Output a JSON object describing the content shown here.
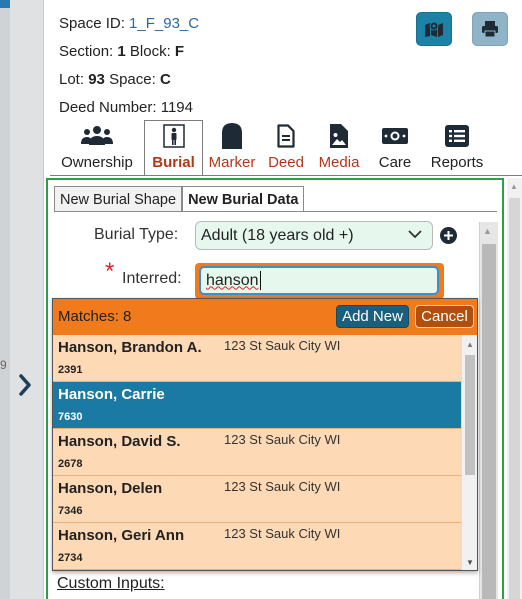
{
  "space_info": {
    "space_id_label": "Space ID:",
    "space_id_value": "1_F_93_C",
    "section_label": "Section:",
    "section_value": "1",
    "block_label": "Block:",
    "block_value": "F",
    "lot_label": "Lot:",
    "lot_value": "93",
    "space_label": "Space:",
    "space_value": "C",
    "deed_label": "Deed Number:",
    "deed_value": "1194"
  },
  "toolbar": {
    "map_icon": "map-icon",
    "print_icon": "printer-icon"
  },
  "tabs": [
    {
      "label": "Ownership",
      "icon": "users-icon"
    },
    {
      "label": "Burial",
      "icon": "person-icon",
      "active": true
    },
    {
      "label": "Marker",
      "icon": "tombstone-icon"
    },
    {
      "label": "Deed",
      "icon": "document-icon"
    },
    {
      "label": "Media",
      "icon": "file-image-icon"
    },
    {
      "label": "Care",
      "icon": "money-icon"
    },
    {
      "label": "Reports",
      "icon": "list-icon"
    }
  ],
  "subtabs": [
    {
      "label": "New Burial Shape"
    },
    {
      "label": "New Burial Data",
      "active": true
    }
  ],
  "form": {
    "burial_type_label": "Burial Type:",
    "burial_type_value": "Adult (18 years old +)",
    "required_star": "*",
    "interred_label": "Interred:",
    "interred_value": "hanson"
  },
  "dropdown": {
    "matches_text": "Matches: 8",
    "add_new_label": "Add New",
    "cancel_label": "Cancel",
    "items": [
      {
        "name": "Hanson, Brandon A.",
        "address": "123 St Sauk City WI",
        "id": "2391"
      },
      {
        "name": "Hanson, Carrie",
        "address": "",
        "id": "7630",
        "selected": true
      },
      {
        "name": "Hanson, David S.",
        "address": "123 St Sauk City WI",
        "id": "2678"
      },
      {
        "name": "Hanson, Delen",
        "address": "123 St Sauk City WI",
        "id": "7346"
      },
      {
        "name": "Hanson, Geri Ann",
        "address": "123 St Sauk City WI",
        "id": "2734"
      }
    ]
  },
  "custom_inputs_label": "Custom Inputs:",
  "colors": {
    "accent_blue": "#1c82a6",
    "selected_row": "#1b7aa3",
    "orange": "#f07a1c",
    "row_bg": "#fdd9b5",
    "active_tab_text": "#b2381a",
    "panel_border": "#2e9e47",
    "input_bg": "#e6f8ed"
  }
}
